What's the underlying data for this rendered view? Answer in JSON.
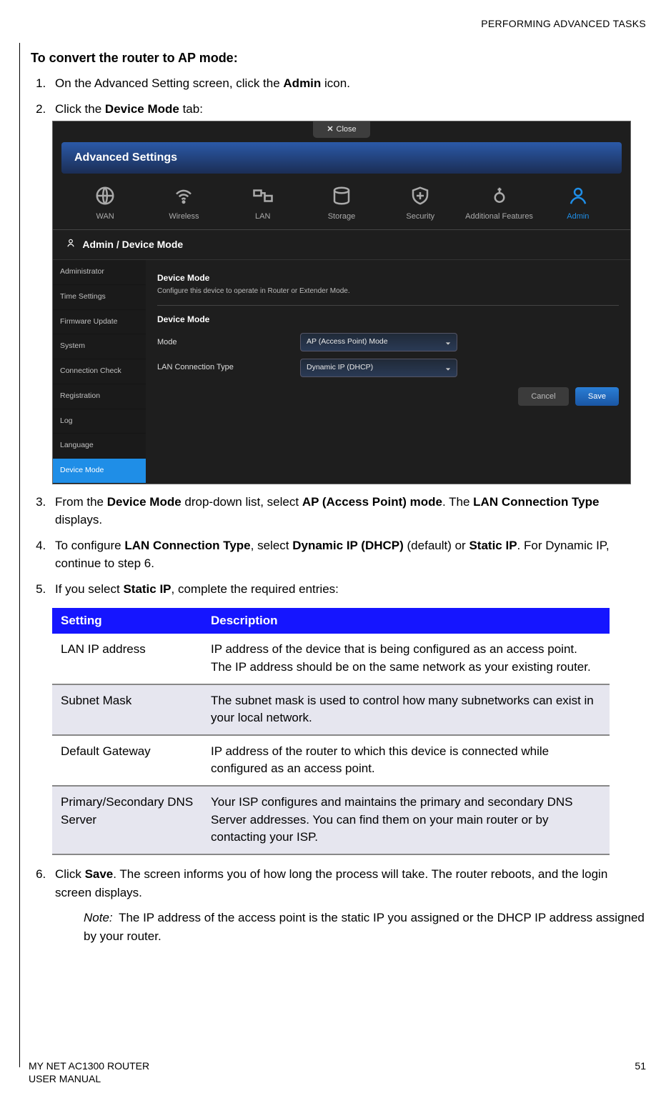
{
  "header": {
    "section": "PERFORMING ADVANCED TASKS"
  },
  "title": "To convert the router to AP mode:",
  "steps": {
    "s1a": "On the Advanced Setting screen, click the ",
    "s1b": "Admin",
    "s1c": " icon.",
    "s2a": "Click the ",
    "s2b": "Device Mode",
    "s2c": " tab:",
    "s3a": "From the ",
    "s3b": "Device Mode",
    "s3c": " drop-down list, select ",
    "s3d": "AP (Access Point) mode",
    "s3e": ". The ",
    "s3f": "LAN Connection Type",
    "s3g": " displays.",
    "s4a": "To configure ",
    "s4b": "LAN Connection Type",
    "s4c": ", select ",
    "s4d": "Dynamic IP (DHCP)",
    "s4e": " (default) or ",
    "s4f": "Static IP",
    "s4g": ". For Dynamic IP, continue to step 6.",
    "s5a": "If you select ",
    "s5b": "Static IP",
    "s5c": ", complete the required entries:",
    "s6a": "Click ",
    "s6b": "Save",
    "s6c": ". The screen informs you of how long the process will take. The router reboots, and the login screen displays."
  },
  "note": {
    "label": "Note:",
    "text": "The IP address of the access point is the static IP you assigned or the DHCP IP address assigned by your router."
  },
  "ui": {
    "close": "Close",
    "title": "Advanced Settings",
    "tabs": [
      "WAN",
      "Wireless",
      "LAN",
      "Storage",
      "Security",
      "Additional Features",
      "Admin"
    ],
    "breadcrumb": "Admin / Device Mode",
    "sidebar": [
      "Administrator",
      "Time Settings",
      "Firmware Update",
      "System",
      "Connection Check",
      "Registration",
      "Log",
      "Language",
      "Device Mode"
    ],
    "section1_title": "Device Mode",
    "section1_desc": "Configure this device to operate in Router or Extender Mode.",
    "section2_title": "Device Mode",
    "row_mode": {
      "label": "Mode",
      "value": "AP (Access Point) Mode"
    },
    "row_lan": {
      "label": "LAN Connection Type",
      "value": "Dynamic IP (DHCP)"
    },
    "cancel": "Cancel",
    "save": "Save"
  },
  "table": {
    "h1": "Setting",
    "h2": "Description",
    "rows": [
      {
        "s": "LAN IP address",
        "d": "IP address of the device that is being configured as an access point. The IP address should be on the same network as your existing router."
      },
      {
        "s": "Subnet Mask",
        "d": "The subnet mask is used to control how many subnetworks can exist in your local network."
      },
      {
        "s": "Default Gateway",
        "d": "IP address of the router to which this device is connected while configured as an access point."
      },
      {
        "s": "Primary/Secondary DNS Server",
        "d": "Your ISP configures and maintains the primary and secondary DNS Server addresses. You can find them on your main router or by contacting your ISP."
      }
    ]
  },
  "footer": {
    "left1": "MY NET AC1300 ROUTER",
    "left2": "USER MANUAL",
    "page": "51"
  }
}
